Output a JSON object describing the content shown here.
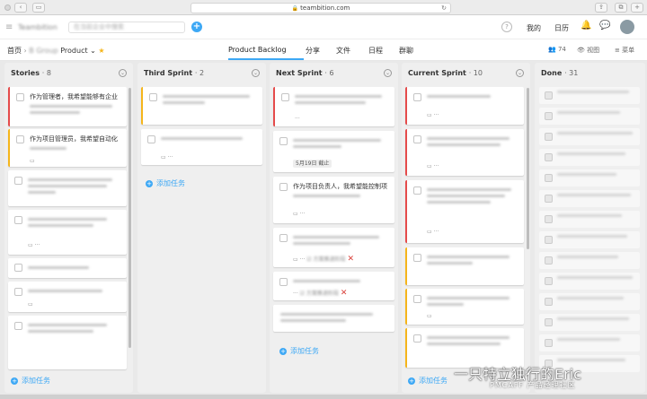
{
  "browser": {
    "url": "teambition.com"
  },
  "topbar": {
    "brand": "Teambition",
    "search_placeholder": "在当前企业中搜索",
    "nav_mine": "我的",
    "nav_calendar": "日历"
  },
  "subbar": {
    "breadcrumb_home": "首页",
    "breadcrumb_project": "Product",
    "tabs": [
      "Product Backlog",
      "分享",
      "文件",
      "日程",
      "群聊"
    ],
    "member_count": "74",
    "view_label": "视图",
    "menu_label": "菜单"
  },
  "columns": [
    {
      "title": "Stories",
      "count": "8",
      "cards": [
        {
          "text": "作为管理者，我希望能够有企业"
        },
        {
          "text": "作为项目管理员，我希望自动化"
        }
      ],
      "add_label": "添加任务"
    },
    {
      "title": "Third Sprint",
      "count": "2",
      "add_label": "添加任务"
    },
    {
      "title": "Next Sprint",
      "count": "6",
      "cards": [
        {
          "date_tag": "5月19日 截止"
        },
        {
          "text": "作为项目负责人，我希望能控制项"
        }
      ],
      "add_label": "添加任务"
    },
    {
      "title": "Current Sprint",
      "count": "10",
      "add_label": "添加任务"
    },
    {
      "title": "Done",
      "count": "31"
    }
  ],
  "watermark": {
    "text": "一只特立独行的Eric",
    "sub": "PMCAFF 产品经理社区"
  }
}
